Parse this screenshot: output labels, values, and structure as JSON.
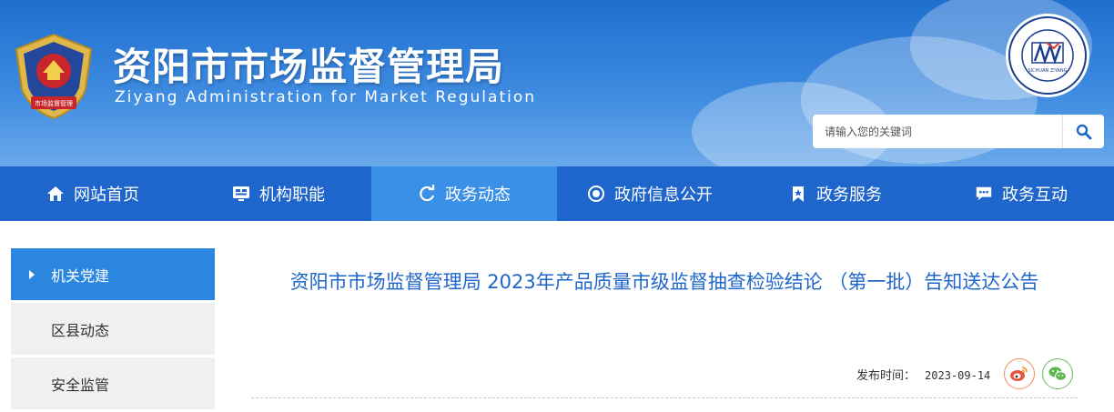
{
  "header": {
    "title": "资阳市市场监督管理局",
    "subtitle": "Ziyang  Administration for  Market Regulation",
    "emblem_text": "市场监督管理",
    "badge_text": "SICHUAN  ZIYANG"
  },
  "search": {
    "placeholder": "请输入您的关键词",
    "icon": "search-icon"
  },
  "nav": [
    {
      "label": "网站首页",
      "icon": "home-icon"
    },
    {
      "label": "机构职能",
      "icon": "monitor-icon"
    },
    {
      "label": "政务动态",
      "icon": "refresh-icon",
      "active": true
    },
    {
      "label": "政府信息公开",
      "icon": "target-icon"
    },
    {
      "label": "政务服务",
      "icon": "bookmark-icon"
    },
    {
      "label": "政务互动",
      "icon": "chat-icon"
    }
  ],
  "sidebar": [
    {
      "label": "机关党建",
      "active": true
    },
    {
      "label": "区县动态"
    },
    {
      "label": "安全监管"
    }
  ],
  "article": {
    "title": "资阳市市场监督管理局 2023年产品质量市级监督抽查检验结论 （第一批）告知送达公告",
    "publish_label": "发布时间：",
    "publish_date": "2023-09-14"
  },
  "share": [
    {
      "icon": "weibo-icon"
    },
    {
      "icon": "wechat-icon"
    }
  ],
  "colors": {
    "nav_bg": "#1f66cc",
    "nav_active": "#3a8fe6",
    "title_blue": "#1f66cc",
    "sidebar_active": "#2b86e0"
  }
}
